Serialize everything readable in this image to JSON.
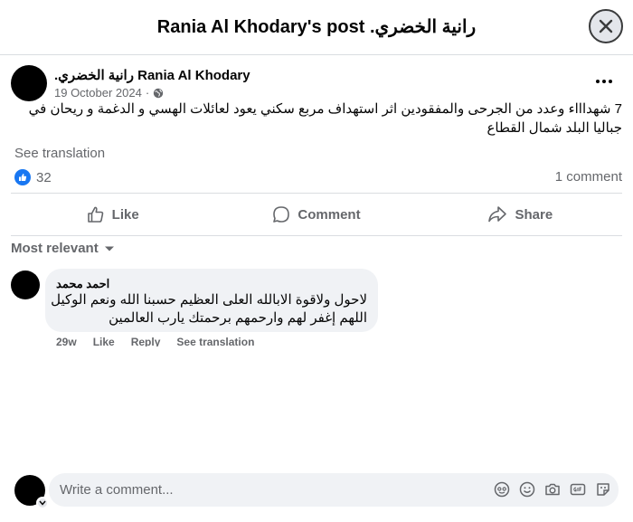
{
  "header": {
    "title": "Rania Al Khodary's post .رانية الخضري"
  },
  "post": {
    "author": ".رانية الخضري Rania Al Khodary",
    "date": "19 October 2024",
    "separator": "·",
    "text": "7 شهداااء وعدد من الجرحى والمفقودين اثر استهداف مربع سكني يعود لعائلات الهسي و الدغمة و ريحان في جباليا البلد شمال القطاع",
    "see_translation": "See translation",
    "reaction_count": "32",
    "comment_count": "1 comment"
  },
  "actions": {
    "like": "Like",
    "comment": "Comment",
    "share": "Share"
  },
  "comments_filter": "Most relevant",
  "comment": {
    "author": "احمد محمد",
    "text": "لاحول ولاقوة الابالله العلى العظيم حسبنا الله ونعم الوكيل اللهم إغفر لهم وارحمهم برحمتك يارب العالمين",
    "age": "29w",
    "like": "Like",
    "reply": "Reply",
    "see_translation": "See translation"
  },
  "composer": {
    "placeholder": "Write a comment..."
  },
  "colors": {
    "accent": "#1877f2",
    "secondary_text": "#65676b",
    "bubble": "#f0f2f5"
  },
  "icons": [
    "close-icon",
    "globe-icon",
    "more-icon",
    "like-reaction-icon",
    "thumbs-up-icon",
    "comment-icon",
    "share-icon",
    "chevron-down-icon",
    "avatar-icon",
    "emoji-icon",
    "camera-icon",
    "gif-icon",
    "sticker-icon"
  ]
}
